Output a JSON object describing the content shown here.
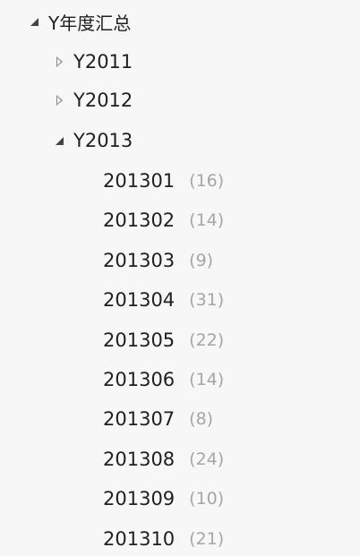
{
  "tree": {
    "root": {
      "label": "Y年度汇总",
      "expanded": true,
      "children": [
        {
          "label": "Y2011",
          "expanded": false
        },
        {
          "label": "Y2012",
          "expanded": false
        },
        {
          "label": "Y2013",
          "expanded": true,
          "items": [
            {
              "label": "201301",
              "count": "(16)"
            },
            {
              "label": "201302",
              "count": "(14)"
            },
            {
              "label": "201303",
              "count": "(9)"
            },
            {
              "label": "201304",
              "count": "(31)"
            },
            {
              "label": "201305",
              "count": "(22)"
            },
            {
              "label": "201306",
              "count": "(14)"
            },
            {
              "label": "201307",
              "count": "(8)"
            },
            {
              "label": "201308",
              "count": "(24)"
            },
            {
              "label": "201309",
              "count": "(10)"
            },
            {
              "label": "201310",
              "count": "(21)"
            }
          ]
        }
      ]
    }
  }
}
